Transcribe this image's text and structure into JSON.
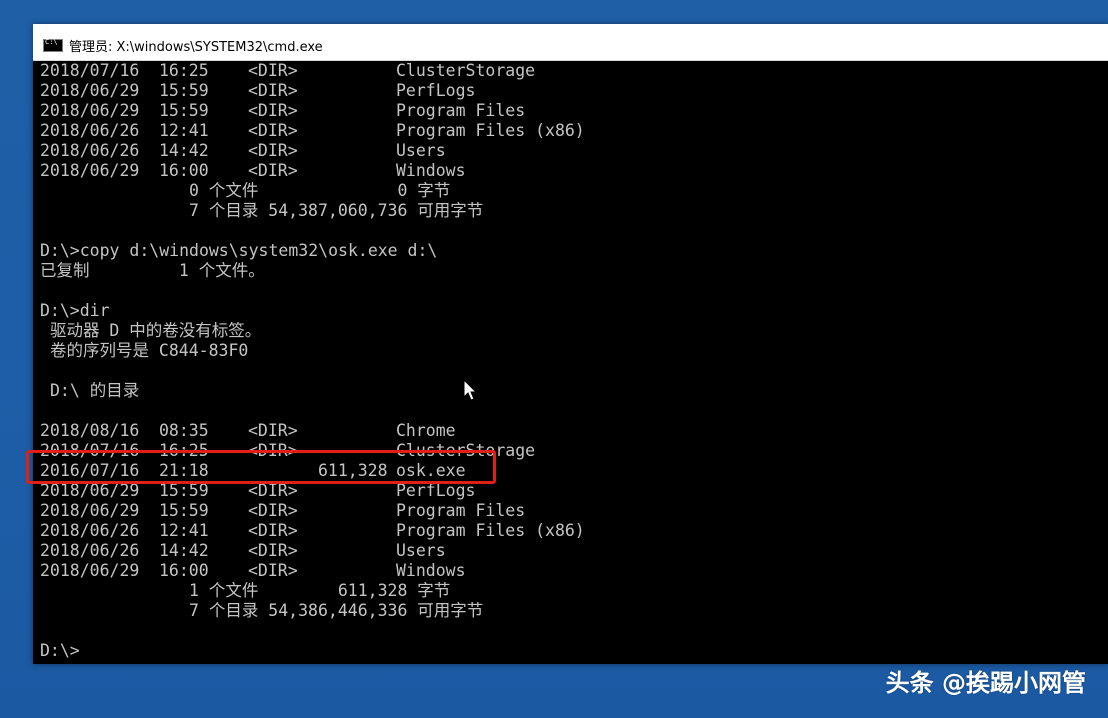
{
  "window": {
    "title": "管理员: X:\\windows\\SYSTEM32\\cmd.exe"
  },
  "console": {
    "listing1": [
      {
        "date": "2018/07/16",
        "time": "16:25",
        "type": "<DIR>",
        "size": "",
        "name": "ClusterStorage"
      },
      {
        "date": "2018/06/29",
        "time": "15:59",
        "type": "<DIR>",
        "size": "",
        "name": "PerfLogs"
      },
      {
        "date": "2018/06/29",
        "time": "15:59",
        "type": "<DIR>",
        "size": "",
        "name": "Program Files"
      },
      {
        "date": "2018/06/26",
        "time": "12:41",
        "type": "<DIR>",
        "size": "",
        "name": "Program Files (x86)"
      },
      {
        "date": "2018/06/26",
        "time": "14:42",
        "type": "<DIR>",
        "size": "",
        "name": "Users"
      },
      {
        "date": "2018/06/29",
        "time": "16:00",
        "type": "<DIR>",
        "size": "",
        "name": "Windows"
      }
    ],
    "summary1": {
      "files_line": "0 个文件              0 字节",
      "dirs_line": "7 个目录 54,387,060,736 可用字节"
    },
    "copy_command": "D:\\>copy d:\\windows\\system32\\osk.exe d:\\",
    "copy_result": "已复制         1 个文件。",
    "dir_command": "D:\\>dir",
    "volume_label": "驱动器 D 中的卷没有标签。",
    "volume_serial": "卷的序列号是 C844-83F0",
    "dir_heading": "D:\\ 的目录",
    "listing2": [
      {
        "date": "2018/08/16",
        "time": "08:35",
        "type": "<DIR>",
        "size": "",
        "name": "Chrome"
      },
      {
        "date": "2018/07/16",
        "time": "16:25",
        "type": "<DIR>",
        "size": "",
        "name": "ClusterStorage"
      },
      {
        "date": "2016/07/16",
        "time": "21:18",
        "type": "",
        "size": "611,328",
        "name": "osk.exe"
      },
      {
        "date": "2018/06/29",
        "time": "15:59",
        "type": "<DIR>",
        "size": "",
        "name": "PerfLogs"
      },
      {
        "date": "2018/06/29",
        "time": "15:59",
        "type": "<DIR>",
        "size": "",
        "name": "Program Files"
      },
      {
        "date": "2018/06/26",
        "time": "12:41",
        "type": "<DIR>",
        "size": "",
        "name": "Program Files (x86)"
      },
      {
        "date": "2018/06/26",
        "time": "14:42",
        "type": "<DIR>",
        "size": "",
        "name": "Users"
      },
      {
        "date": "2018/06/29",
        "time": "16:00",
        "type": "<DIR>",
        "size": "",
        "name": "Windows"
      }
    ],
    "summary2": {
      "files_line": "1 个文件        611,328 字节",
      "dirs_line": "7 个目录 54,386,446,336 可用字节"
    },
    "prompt": "D:\\>"
  },
  "watermark": "头条 @挨踢小网管",
  "colors": {
    "desktop": "#1e5ea8",
    "console_bg": "#000000",
    "console_text": "#c4c4c4",
    "highlight": "#e02018"
  }
}
